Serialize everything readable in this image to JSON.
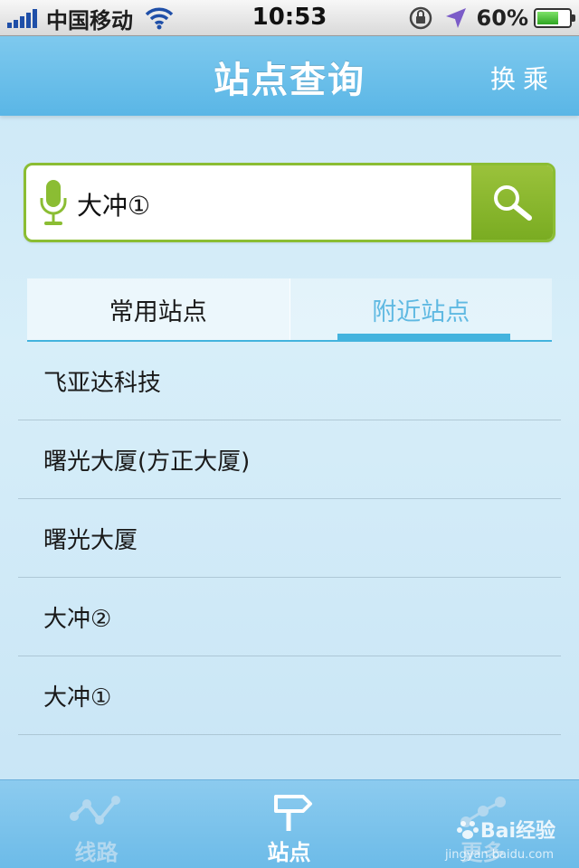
{
  "status_bar": {
    "carrier": "中国移动",
    "time": "10:53",
    "battery_percent": "60%",
    "battery_level": 0.6,
    "icons": [
      "signal-icon",
      "wifi-icon",
      "rotation-lock-icon",
      "location-arrow-icon",
      "battery-icon"
    ]
  },
  "header": {
    "title": "站点查询",
    "right_button": "换乘"
  },
  "search": {
    "value": "大冲①",
    "placeholder": "",
    "colors": {
      "border": "#8bbd33",
      "button": "#7aac22"
    }
  },
  "tabs": [
    {
      "label": "常用站点",
      "active": false
    },
    {
      "label": "附近站点",
      "active": true
    }
  ],
  "stations": [
    "飞亚达科技",
    "曙光大厦(方正大厦)",
    "曙光大厦",
    "大冲②",
    "大冲①"
  ],
  "tab_bar": {
    "items": [
      {
        "label": "线路",
        "icon": "route-line-icon",
        "active": false
      },
      {
        "label": "站点",
        "icon": "signpost-icon",
        "active": true
      },
      {
        "label": "更多",
        "icon": "more-icon",
        "active": false
      }
    ]
  },
  "watermark": {
    "brand": "Bai经验",
    "url": "jingyan.baidu.com"
  },
  "colors": {
    "accent": "#43b3de",
    "nav": "#5ab6e6",
    "green": "#8bbd33"
  }
}
